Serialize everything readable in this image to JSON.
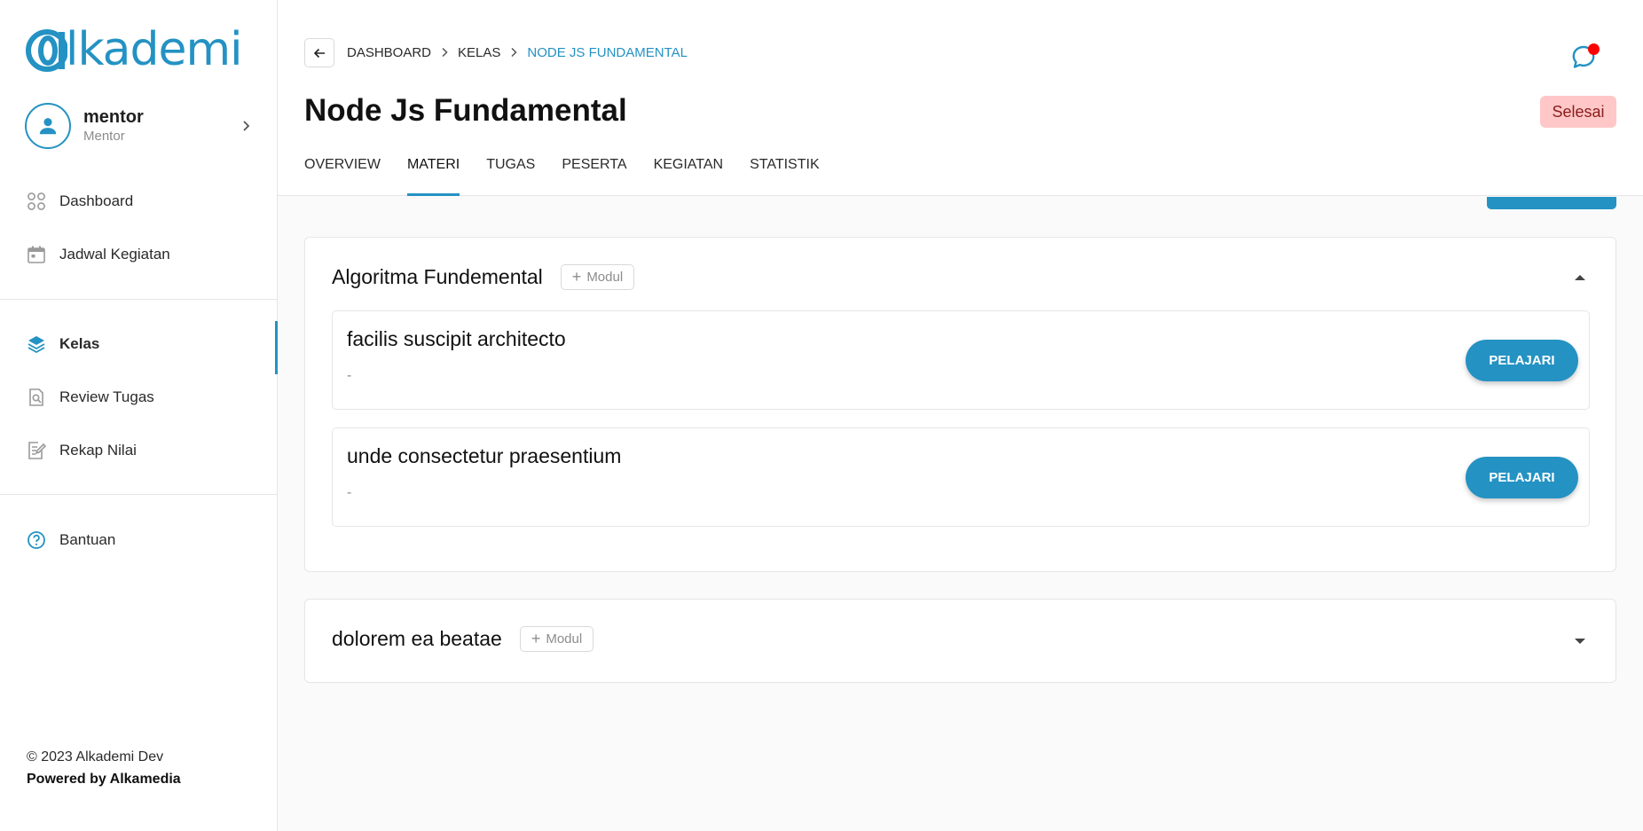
{
  "brand": {
    "logo_text": "lkademi",
    "accent": "#2492c3"
  },
  "user": {
    "name": "mentor",
    "role": "Mentor"
  },
  "sidebar": {
    "items": [
      {
        "label": "Dashboard",
        "icon": "grid-icon"
      },
      {
        "label": "Jadwal Kegiatan",
        "icon": "calendar-icon"
      },
      {
        "label": "Kelas",
        "icon": "layers-icon",
        "active": true
      },
      {
        "label": "Review Tugas",
        "icon": "document-search-icon"
      },
      {
        "label": "Rekap Nilai",
        "icon": "edit-note-icon"
      },
      {
        "label": "Bantuan",
        "icon": "help-circle-icon"
      }
    ],
    "footer": {
      "copyright": "© 2023 Alkademi Dev",
      "powered": "Powered by Alkamedia"
    }
  },
  "header": {
    "breadcrumb": [
      "DASHBOARD",
      "KELAS",
      "NODE JS FUNDAMENTAL"
    ],
    "title": "Node Js Fundamental",
    "status": "Selesai",
    "tabs": [
      "OVERVIEW",
      "MATERI",
      "TUGAS",
      "PESERTA",
      "KEGIATAN",
      "STATISTIK"
    ],
    "active_tab": "MATERI"
  },
  "sections": [
    {
      "title": "Algoritma Fundemental",
      "modul_label": "Modul",
      "expanded": true,
      "items": [
        {
          "title": "facilis suscipit architecto",
          "desc": "-",
          "action": "PELAJARI"
        },
        {
          "title": "unde consectetur praesentium",
          "desc": "-",
          "action": "PELAJARI"
        }
      ]
    },
    {
      "title": "dolorem ea beatae",
      "modul_label": "Modul",
      "expanded": false,
      "items": []
    }
  ]
}
